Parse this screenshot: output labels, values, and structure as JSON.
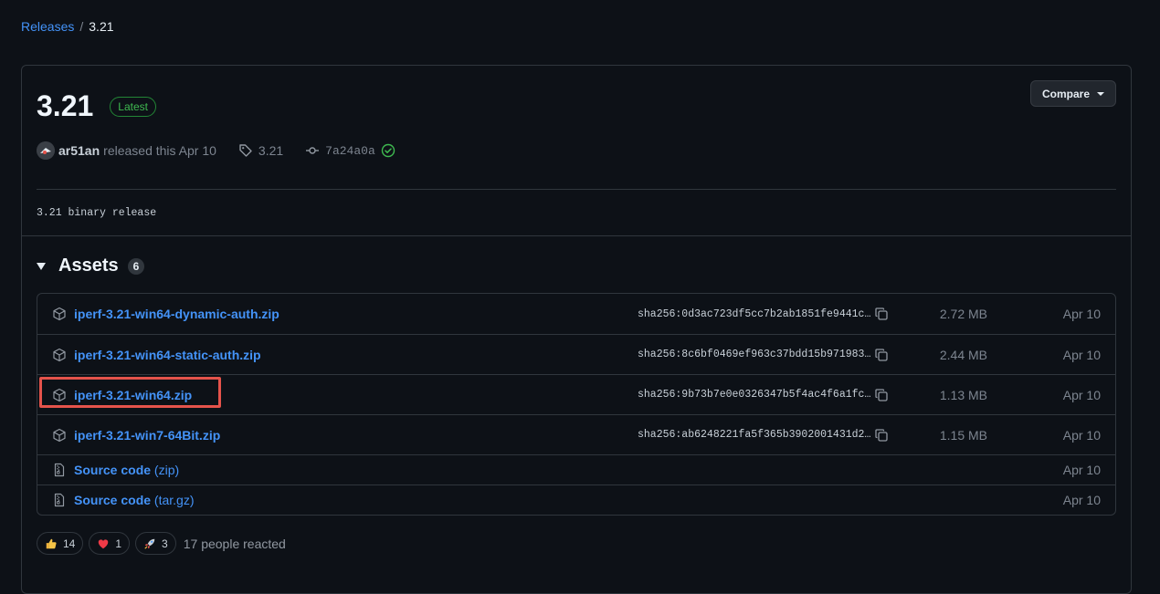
{
  "breadcrumb": {
    "parent": "Releases",
    "separator": "/",
    "current": "3.21"
  },
  "release": {
    "title": "3.21",
    "badge": "Latest",
    "compare_label": "Compare",
    "author": "ar51an",
    "released_text": "released this Apr 10",
    "tag": "3.21",
    "commit": "7a24a0a",
    "body": "3.21 binary release"
  },
  "assets": {
    "title": "Assets",
    "count": "6",
    "files": [
      {
        "name": "iperf-3.21-win64-dynamic-auth.zip",
        "sha": "sha256:0d3ac723df5cc7b2ab1851fe9441c…",
        "size": "2.72 MB",
        "date": "Apr 10"
      },
      {
        "name": "iperf-3.21-win64-static-auth.zip",
        "sha": "sha256:8c6bf0469ef963c37bdd15b971983…",
        "size": "2.44 MB",
        "date": "Apr 10"
      },
      {
        "name": "iperf-3.21-win64.zip",
        "sha": "sha256:9b73b7e0e0326347b5f4ac4f6a1fc…",
        "size": "1.13 MB",
        "date": "Apr 10"
      },
      {
        "name": "iperf-3.21-win7-64Bit.zip",
        "sha": "sha256:ab6248221fa5f365b3902001431d2…",
        "size": "1.15 MB",
        "date": "Apr 10"
      }
    ],
    "source": [
      {
        "label": "Source code",
        "format": "(zip)",
        "date": "Apr 10"
      },
      {
        "label": "Source code",
        "format": "(tar.gz)",
        "date": "Apr 10"
      }
    ]
  },
  "reactions": {
    "items": [
      {
        "icon": "thumbs-up-icon",
        "count": "14"
      },
      {
        "icon": "heart-icon",
        "count": "1"
      },
      {
        "icon": "rocket-icon",
        "count": "3"
      }
    ],
    "summary": "17 people reacted"
  },
  "colors": {
    "accent_link": "#4493f8",
    "latest_badge": "#3fb950",
    "highlight": "#e5534b",
    "background": "#0d1117"
  }
}
